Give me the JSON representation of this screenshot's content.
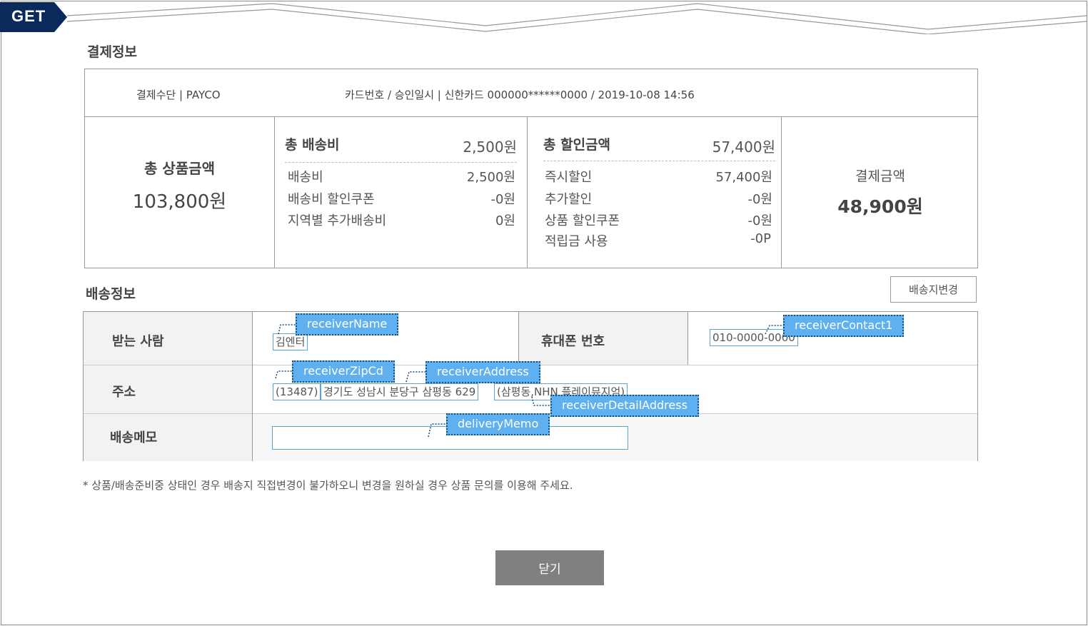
{
  "method_tag": "GET",
  "payment": {
    "section_title": "결제정보",
    "method_text": "결제수단 | PAYCO",
    "card_text": "카드번호 / 승인일시 |  신한카드 000000******0000 / 2019-10-08 14:56",
    "total_product": {
      "label": "총 상품금액",
      "value": "103,800원"
    },
    "shipping": {
      "label": "총 배송비",
      "value": "2,500원",
      "items": [
        {
          "label": "배송비",
          "value": "2,500원"
        },
        {
          "label": "배송비 할인쿠폰",
          "value": "-0원"
        },
        {
          "label": "지역별 추가배송비",
          "value": "0원"
        }
      ]
    },
    "discount": {
      "label": "총 할인금액",
      "value": "57,400원",
      "items": [
        {
          "label": "즉시할인",
          "value": "57,400원"
        },
        {
          "label": "추가할인",
          "value": "-0원"
        },
        {
          "label": "상품 할인쿠폰",
          "value": "-0원"
        },
        {
          "label": "적립금 사용",
          "value": "-0P"
        }
      ]
    },
    "final": {
      "label": "결제금액",
      "value": "48,900원"
    }
  },
  "delivery": {
    "section_title": "배송정보",
    "change_button": "배송지변경",
    "receiver_label": "받는 사람",
    "receiver_name": "김엔터",
    "phone_label": "휴대폰 번호",
    "phone": "010-0000-0000",
    "address_label": "주소",
    "zip": "(13487)",
    "address": "경기도 성남시 분당구 삼평동 629",
    "detail_address": "(삼평동,NHN 플레이뮤지엄)",
    "memo_label": "배송메모",
    "memo": ""
  },
  "annotations": {
    "receiver_name": "receiverName",
    "receiver_contact": "receiverContact1",
    "receiver_zip": "receiverZipCd",
    "receiver_address": "receiverAddress",
    "receiver_detail": "receiverDetailAddress",
    "delivery_memo": "deliveryMemo"
  },
  "notice": "* 상품/배송준비중 상태인 경우 배송지 직접변경이 불가하오니 변경을 원하실 경우 상품 문의를 이용해 주세요.",
  "close_button": "닫기",
  "colors": {
    "tag_fill": "#0a2a5c",
    "annotation_fill": "#5fb0f0",
    "annotation_border": "#1a4d80",
    "field_border": "#5aa4d6",
    "close_button": "#808080"
  }
}
